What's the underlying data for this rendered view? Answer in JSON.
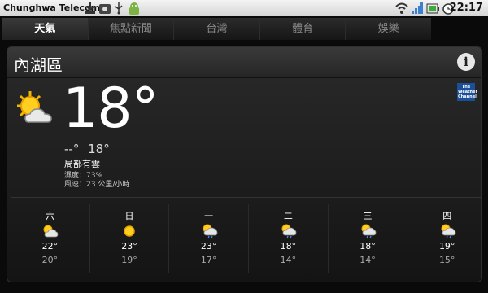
{
  "status_bar": {
    "carrier": "Chunghwa Telecom",
    "clock": "22:17",
    "icons": [
      "download-icon",
      "camera-icon",
      "usb-icon",
      "android-icon",
      "wifi-icon",
      "signal-icon",
      "battery-icon",
      "alarm-icon"
    ]
  },
  "tabs": [
    {
      "label": "天氣",
      "active": true
    },
    {
      "label": "焦點新聞",
      "active": false
    },
    {
      "label": "台灣",
      "active": false
    },
    {
      "label": "體育",
      "active": false
    },
    {
      "label": "娛樂",
      "active": false
    }
  ],
  "weather": {
    "location": "內湖區",
    "info_label": "i",
    "provider_logo": "The Weather Channel",
    "current_temp": "18°",
    "feels_dash": "--°",
    "feels_temp": "18°",
    "condition": "局部有雲",
    "humidity": "濕度：73%",
    "wind": "風速：23 公里/小時",
    "forecast": [
      {
        "day": "六",
        "icon": "partly-cloudy-icon",
        "hi": "22°",
        "lo": "20°"
      },
      {
        "day": "日",
        "icon": "sunny-icon",
        "hi": "23°",
        "lo": "19°"
      },
      {
        "day": "一",
        "icon": "partly-cloudy-rain-icon",
        "hi": "23°",
        "lo": "17°"
      },
      {
        "day": "二",
        "icon": "partly-cloudy-rain-icon",
        "hi": "18°",
        "lo": "14°"
      },
      {
        "day": "三",
        "icon": "partly-cloudy-rain-icon",
        "hi": "18°",
        "lo": "14°"
      },
      {
        "day": "四",
        "icon": "partly-cloudy-rain-icon",
        "hi": "19°",
        "lo": "15°"
      }
    ]
  }
}
